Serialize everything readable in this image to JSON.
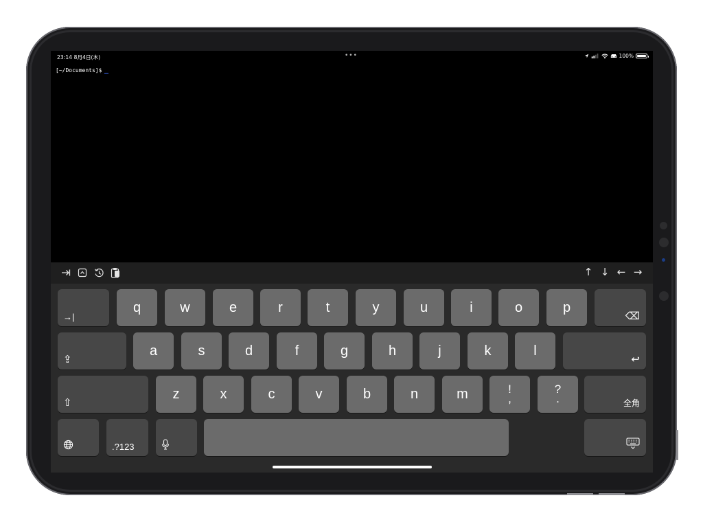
{
  "status_bar": {
    "time": "23:14  8月4日(木)",
    "dots": "•••",
    "battery": "100%",
    "icons": [
      "location-icon",
      "signal-icon",
      "wifi-icon",
      "car-icon",
      "battery-icon"
    ]
  },
  "terminal": {
    "prompt": "[~/Documents]$"
  },
  "accessory": {
    "left_icons": [
      "tab-icon",
      "control-icon",
      "history-icon",
      "paste-icon"
    ],
    "arrows": [
      "↑",
      "↓",
      "←",
      "→"
    ]
  },
  "keyboard": {
    "row1": [
      "q",
      "w",
      "e",
      "r",
      "t",
      "y",
      "u",
      "i",
      "o",
      "p"
    ],
    "row2": [
      "a",
      "s",
      "d",
      "f",
      "g",
      "h",
      "j",
      "k",
      "l"
    ],
    "row3": [
      "z",
      "x",
      "c",
      "v",
      "b",
      "n",
      "m"
    ],
    "punct1": {
      "top": "!",
      "bottom": ","
    },
    "punct2": {
      "top": "?",
      "bottom": "."
    },
    "tab_label": "→|",
    "delete_symbol": "⌫",
    "return_symbol": "↩",
    "shift_symbol": "⇧",
    "caps_symbol": "⇪",
    "kana_label": "全角",
    "numbers_label": ".?123",
    "globe_symbol": "🌐",
    "mic_symbol": "🎙",
    "dismiss_symbol": "⌨"
  },
  "colors": {
    "screen_bg": "#000000",
    "cursor": "#3b6cff",
    "key_light": "#6b6b6b",
    "key_dark": "#474747",
    "keyboard_bg": "#2a2a2a"
  }
}
